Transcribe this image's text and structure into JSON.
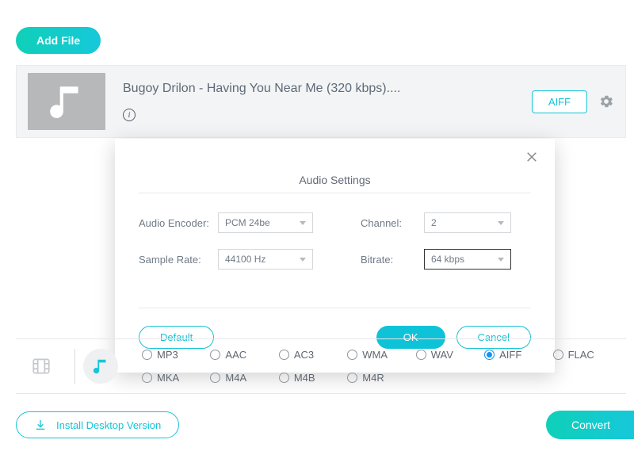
{
  "toolbar": {
    "add_file": "Add File"
  },
  "file": {
    "title": "Bugoy Drilon - Having You Near Me (320 kbps)....",
    "format_chip": "AIFF"
  },
  "modal": {
    "title": "Audio Settings",
    "labels": {
      "encoder": "Audio Encoder:",
      "sample_rate": "Sample Rate:",
      "channel": "Channel:",
      "bitrate": "Bitrate:"
    },
    "values": {
      "encoder": "PCM 24be",
      "sample_rate": "44100 Hz",
      "channel": "2",
      "bitrate": "64 kbps"
    },
    "buttons": {
      "default": "Default",
      "ok": "OK",
      "cancel": "Cancel"
    }
  },
  "formats": {
    "row1": [
      "MP3",
      "AAC",
      "AC3",
      "WMA",
      "WAV",
      "AIFF",
      "FLAC"
    ],
    "row2": [
      "MKA",
      "M4A",
      "M4B",
      "M4R"
    ],
    "selected": "AIFF"
  },
  "bottom": {
    "install": "Install Desktop Version",
    "convert": "Convert"
  }
}
